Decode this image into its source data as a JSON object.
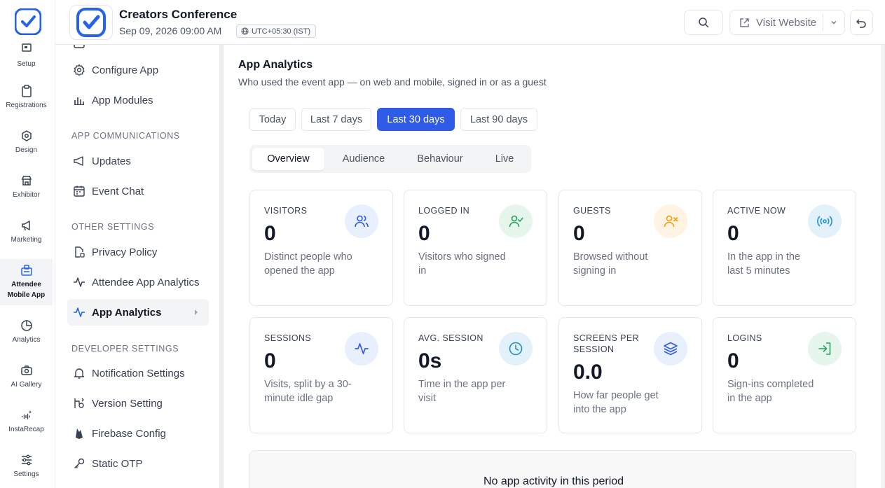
{
  "rail": {
    "items": [
      {
        "label": "Setup"
      },
      {
        "label": "Registrations"
      },
      {
        "label": "Design"
      },
      {
        "label": "Exhibitor"
      },
      {
        "label": "Marketing"
      },
      {
        "label": "Attendee Mobile App"
      },
      {
        "label": "Analytics"
      },
      {
        "label": "AI Gallery"
      },
      {
        "label": "InstaRecap"
      },
      {
        "label": "Settings"
      }
    ]
  },
  "header": {
    "event_title": "Creators Conference",
    "event_date": "Sep 09, 2026 09:00 AM",
    "timezone": "UTC+05:30 (IST)",
    "visit_website_label": "Visit Website"
  },
  "menu": {
    "items_top": [
      {
        "label": "Configure App"
      },
      {
        "label": "App Modules"
      }
    ],
    "section_comms": "APP COMMUNICATIONS",
    "items_comms": [
      {
        "label": "Updates"
      },
      {
        "label": "Event Chat"
      }
    ],
    "section_other": "OTHER SETTINGS",
    "items_other": [
      {
        "label": "Privacy Policy"
      },
      {
        "label": "Attendee App Analytics"
      },
      {
        "label": "App Analytics"
      }
    ],
    "section_dev": "DEVELOPER SETTINGS",
    "items_dev": [
      {
        "label": "Notification Settings"
      },
      {
        "label": "Version Setting"
      },
      {
        "label": "Firebase Config"
      },
      {
        "label": "Static OTP"
      }
    ]
  },
  "main": {
    "title": "App Analytics",
    "subtitle": "Who used the event app — on web and mobile, signed in or as a guest",
    "ranges": [
      {
        "label": "Today"
      },
      {
        "label": "Last 7 days"
      },
      {
        "label": "Last 30 days"
      },
      {
        "label": "Last 90 days"
      }
    ],
    "selected_range": "Last 30 days",
    "tabs": [
      {
        "label": "Overview"
      },
      {
        "label": "Audience"
      },
      {
        "label": "Behaviour"
      },
      {
        "label": "Live"
      }
    ],
    "selected_tab": "Overview",
    "cards": [
      {
        "label": "VISITORS",
        "value": "0",
        "desc": "Distinct people who opened the app",
        "icon": "users-icon"
      },
      {
        "label": "LOGGED IN",
        "value": "0",
        "desc": "Visitors who signed in",
        "icon": "user-check-icon"
      },
      {
        "label": "GUESTS",
        "value": "0",
        "desc": "Browsed without signing in",
        "icon": "user-x-icon"
      },
      {
        "label": "ACTIVE NOW",
        "value": "0",
        "desc": "In the app in the last 5 minutes",
        "icon": "broadcast-icon"
      },
      {
        "label": "SESSIONS",
        "value": "0",
        "desc": "Visits, split by a 30-minute idle gap",
        "icon": "activity-icon"
      },
      {
        "label": "AVG. SESSION",
        "value": "0s",
        "desc": "Time in the app per visit",
        "icon": "clock-icon"
      },
      {
        "label": "SCREENS PER SESSION",
        "value": "0.0",
        "desc": "How far people get into the app",
        "icon": "layers-icon"
      },
      {
        "label": "LOGINS",
        "value": "0",
        "desc": "Sign-ins completed in the app",
        "icon": "login-icon"
      }
    ],
    "empty_state": "No app activity in this period"
  },
  "colors": {
    "accent": "#2f5be6",
    "brand": "#2563eb",
    "icon_blue_bg": "#e8effd",
    "icon_green_bg": "#e7f6ec",
    "icon_orange_bg": "#fff3e3"
  }
}
